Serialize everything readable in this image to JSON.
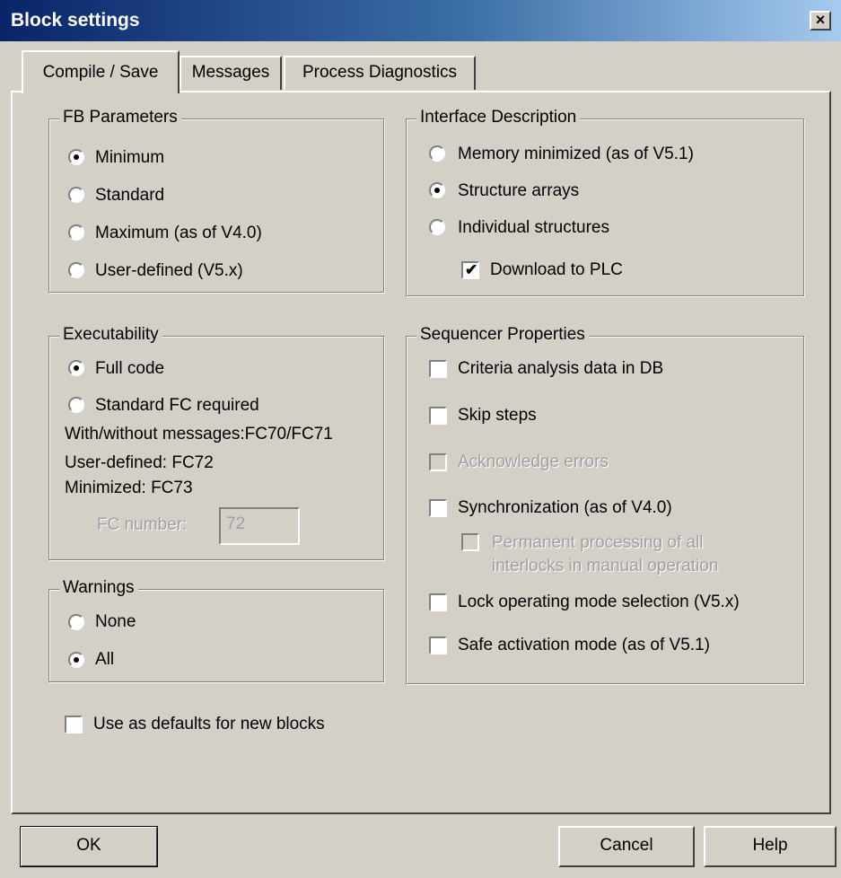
{
  "window": {
    "title": "Block settings",
    "close_glyph": "×"
  },
  "tabs": [
    {
      "label": "Compile / Save",
      "active": true
    },
    {
      "label": "Messages",
      "active": false
    },
    {
      "label": "Process Diagnostics",
      "active": false
    }
  ],
  "fb_parameters": {
    "legend": "FB Parameters",
    "options": [
      "Minimum",
      "Standard",
      "Maximum (as of V4.0)",
      "User-defined (V5.x)"
    ],
    "selected": "Minimum"
  },
  "executability": {
    "legend": "Executability",
    "options": [
      "Full code",
      "Standard FC required"
    ],
    "selected": "Full code",
    "info_lines": [
      "With/without messages:FC70/FC71",
      "User-defined: FC72",
      "Minimized: FC73"
    ],
    "fc_number_label": "FC number:",
    "fc_number_value": "72"
  },
  "warnings": {
    "legend": "Warnings",
    "options": [
      "None",
      "All"
    ],
    "selected": "All"
  },
  "interface_description": {
    "legend": "Interface Description",
    "options": [
      "Memory minimized (as of V5.1)",
      "Structure arrays",
      "Individual structures"
    ],
    "selected": "Structure arrays",
    "download_label": "Download to PLC",
    "download_checked": true
  },
  "sequencer_properties": {
    "legend": "Sequencer Properties",
    "criteria_analysis": "Criteria analysis data in DB",
    "skip_steps": "Skip steps",
    "acknowledge_errors": "Acknowledge errors",
    "synchronization": "Synchronization (as of V4.0)",
    "permanent_processing_line1": "Permanent processing of all",
    "permanent_processing_line2": "interlocks in manual operation",
    "lock_mode": "Lock operating mode selection (V5.x)",
    "safe_activation": "Safe activation mode (as of V5.1)"
  },
  "defaults_checkbox": {
    "label": "Use as defaults for new blocks",
    "checked": false
  },
  "buttons": {
    "ok": "OK",
    "cancel": "Cancel",
    "help": "Help"
  },
  "icons": {
    "checkmark": "✔"
  }
}
